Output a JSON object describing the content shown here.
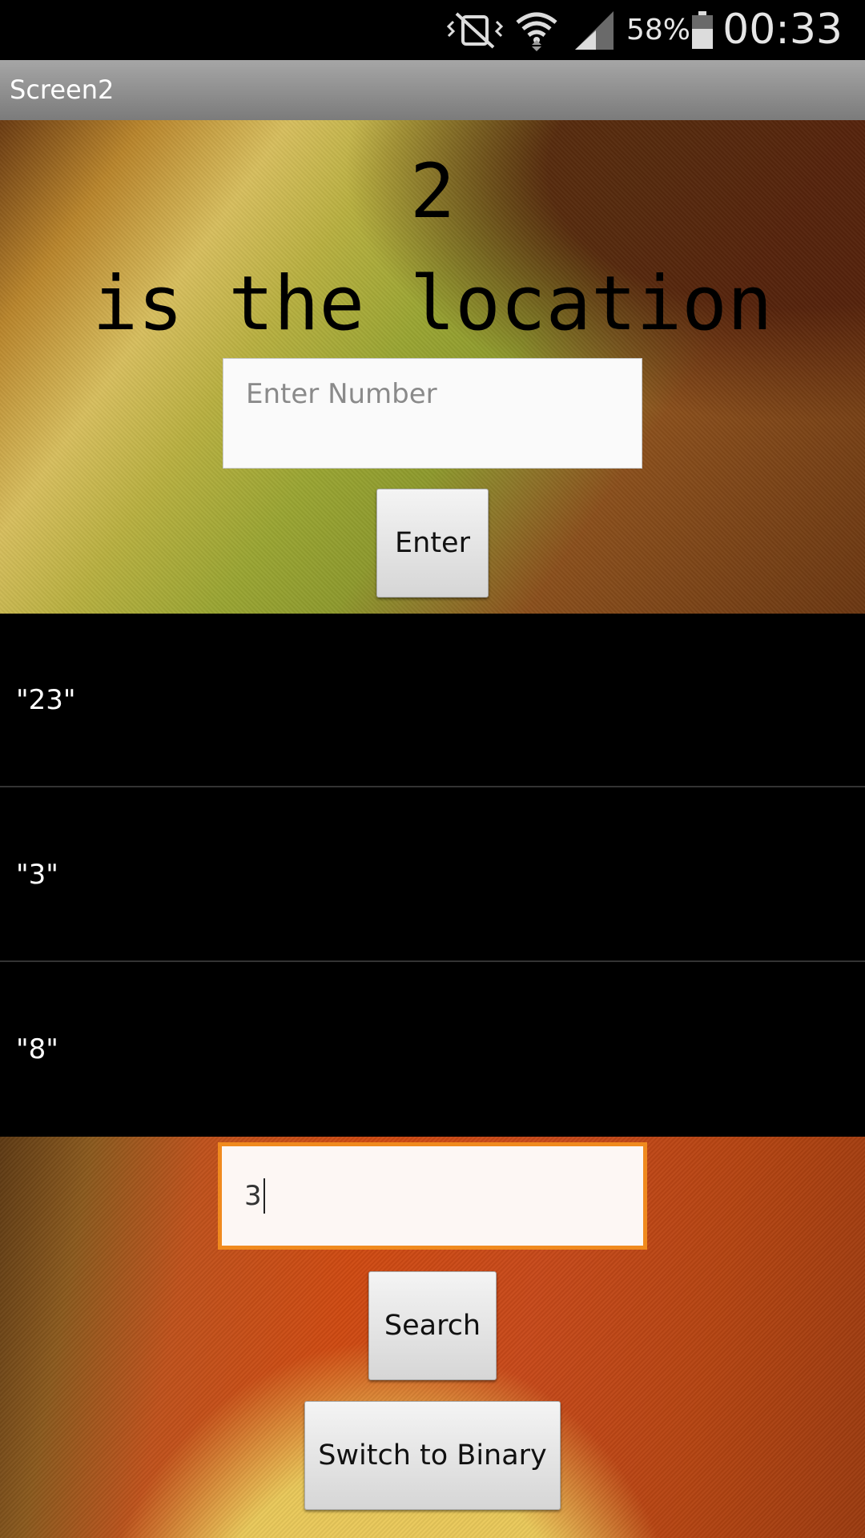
{
  "status_bar": {
    "battery_percent": "58%",
    "time": "00:33",
    "icons": [
      "vibrate-mute-icon",
      "wifi-icon",
      "signal-icon",
      "battery-icon"
    ]
  },
  "title_bar": {
    "title": "Screen2"
  },
  "result": {
    "number": "2",
    "message": "is the location"
  },
  "enter_input": {
    "placeholder": "Enter Number",
    "value": ""
  },
  "enter_button": {
    "label": "Enter"
  },
  "list": {
    "items": [
      "\"23\"",
      "\"3\"",
      "\"8\""
    ]
  },
  "search_input": {
    "value": "3"
  },
  "search_button": {
    "label": "Search"
  },
  "switch_button": {
    "label": "Switch to Binary"
  },
  "colors": {
    "focus_border": "#f08a1e",
    "title_bar": "#8e8e8e",
    "list_bg": "#000000"
  }
}
